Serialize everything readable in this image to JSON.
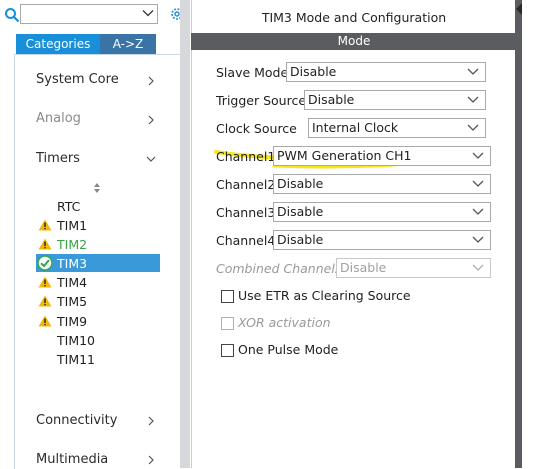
{
  "toolbar": {
    "search": {
      "value": "",
      "placeholder": ""
    },
    "icons": [
      "search-icon",
      "chevron-down-icon",
      "gear-icon"
    ]
  },
  "tabs": [
    {
      "label": "Categories",
      "active": true
    },
    {
      "label": "A->Z",
      "active": false
    }
  ],
  "categories": [
    {
      "label": "System Core",
      "enabled": true,
      "expanded": false
    },
    {
      "label": "Analog",
      "enabled": false,
      "expanded": false
    },
    {
      "label": "Timers",
      "enabled": true,
      "expanded": true
    },
    {
      "label": "Connectivity",
      "enabled": true,
      "expanded": false
    },
    {
      "label": "Multimedia",
      "enabled": true,
      "expanded": false
    }
  ],
  "timers": [
    {
      "label": "RTC",
      "status": "none"
    },
    {
      "label": "TIM1",
      "status": "warning"
    },
    {
      "label": "TIM2",
      "status": "warning"
    },
    {
      "label": "TIM3",
      "status": "ok",
      "selected": true
    },
    {
      "label": "TIM4",
      "status": "warning"
    },
    {
      "label": "TIM5",
      "status": "warning"
    },
    {
      "label": "TIM9",
      "status": "warning"
    },
    {
      "label": "TIM10",
      "status": "none"
    },
    {
      "label": "TIM11",
      "status": "none"
    }
  ],
  "colors": {
    "tab_active": "#1a8fd9",
    "tab_inactive": "#3a73a6",
    "selection": "#3a9ad9",
    "warning": "#f2b705",
    "ok": "#2fa84f",
    "tim2_text": "#3aa34a",
    "mode_header": "#5a5c60",
    "highlight": "#f5e400"
  },
  "panel": {
    "title": "TIM3 Mode and Configuration",
    "section": "Mode",
    "fields": [
      {
        "label": "Slave Mode",
        "value": "Disable",
        "enabled": true
      },
      {
        "label": "Trigger Source",
        "value": "Disable",
        "enabled": true
      },
      {
        "label": "Clock Source",
        "value": "Internal Clock",
        "enabled": true
      },
      {
        "label": "Channel1",
        "value": "PWM Generation CH1",
        "enabled": true,
        "highlighted": true
      },
      {
        "label": "Channel2",
        "value": "Disable",
        "enabled": true
      },
      {
        "label": "Channel3",
        "value": "Disable",
        "enabled": true
      },
      {
        "label": "Channel4",
        "value": "Disable",
        "enabled": true
      },
      {
        "label": "Combined Channels",
        "value": "Disable",
        "enabled": false
      }
    ],
    "checkboxes": [
      {
        "label": "Use ETR as Clearing Source",
        "checked": false,
        "enabled": true
      },
      {
        "label": "XOR activation",
        "checked": false,
        "enabled": false
      },
      {
        "label": "One Pulse Mode",
        "checked": false,
        "enabled": true
      }
    ]
  }
}
